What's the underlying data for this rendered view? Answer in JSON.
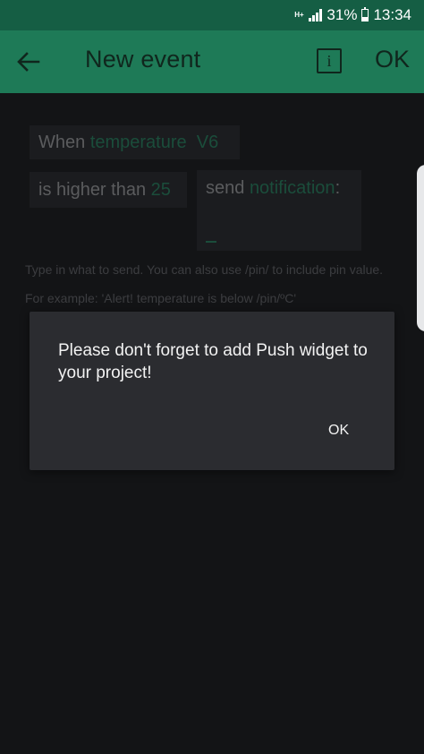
{
  "status_bar": {
    "network_type": "H+",
    "battery_percent": "31%",
    "battery_level": 0.31,
    "time": "13:34",
    "icons": [
      "signal-icon",
      "battery-icon"
    ]
  },
  "app_bar": {
    "title": "New event",
    "info_label": "i",
    "ok_label": "OK",
    "back_icon": "back-arrow-icon",
    "color": "#1e7a57"
  },
  "event_rule": {
    "when_label": "When",
    "sensor_name": "temperature",
    "pin": "V6",
    "condition_label": "is higher than",
    "threshold": "25",
    "send_label": "send",
    "action": "notification",
    "colon": ":",
    "cursor": "_"
  },
  "hints": {
    "line1": "Type in what to send. You can also use /pin/ to include pin value.",
    "line2": "For example: 'Alert! temperature is below /pin/ºC'"
  },
  "dialog": {
    "message": "Please don't forget to add Push widget to your project!",
    "ok_label": "OK"
  }
}
